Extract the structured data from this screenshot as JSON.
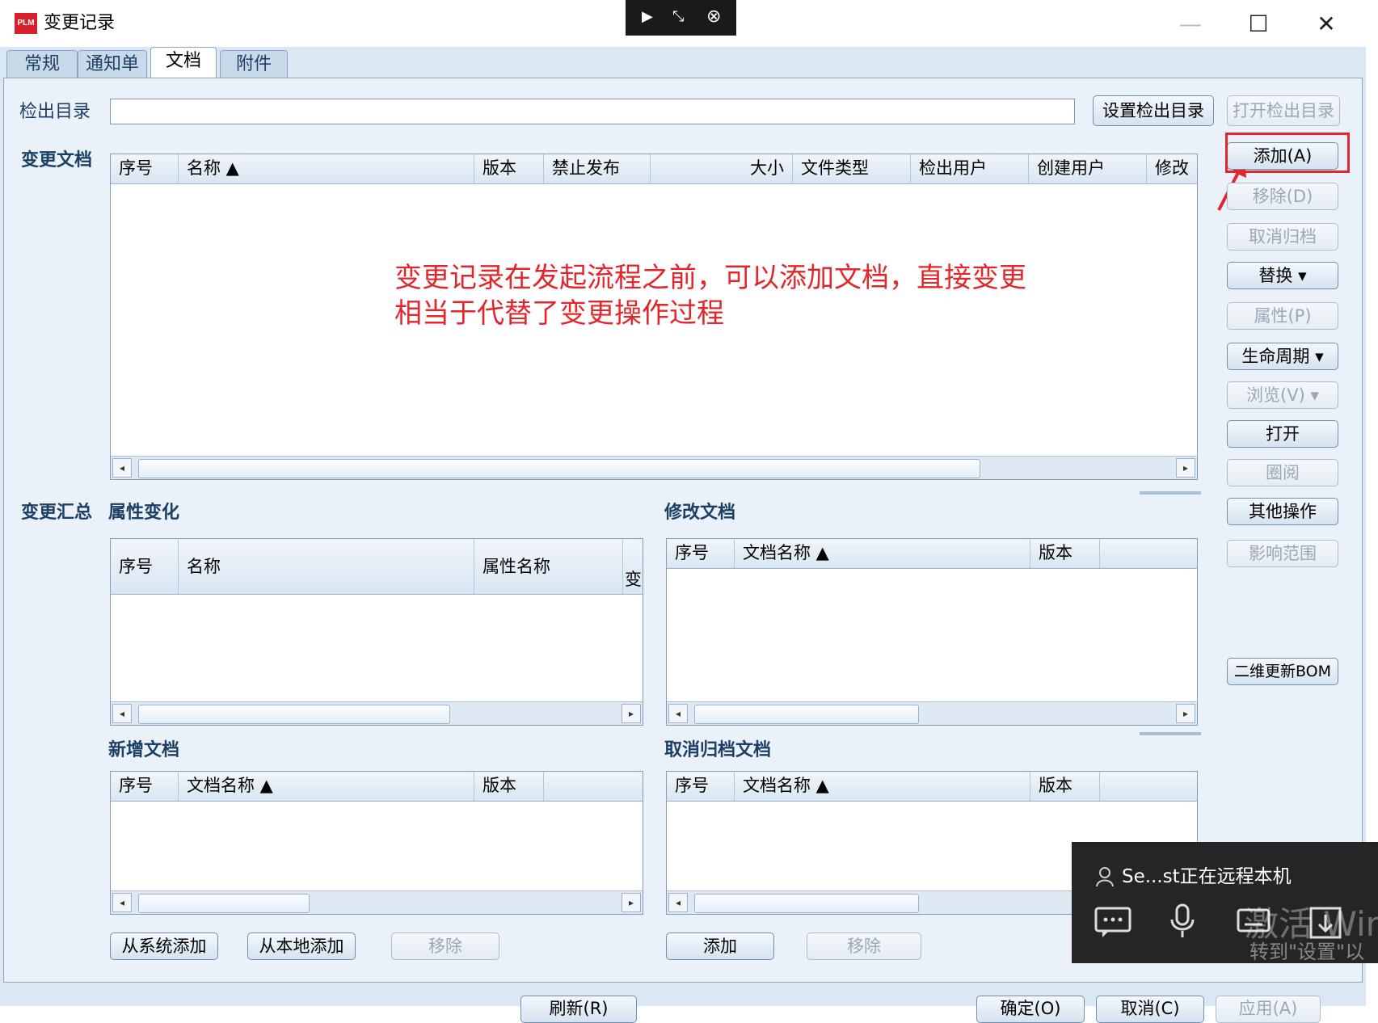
{
  "window": {
    "logo": "PLM",
    "title": "变更记录",
    "minimize": "—",
    "maximize": "☐",
    "close": "✕"
  },
  "remote_bar": {
    "pin": "▶",
    "restore": "⤡",
    "close": "⊗"
  },
  "tabs": [
    {
      "label": "常规",
      "active": false
    },
    {
      "label": "通知单",
      "active": false
    },
    {
      "label": "文档",
      "active": true
    },
    {
      "label": "附件",
      "active": false
    }
  ],
  "checkout": {
    "label": "检出目录",
    "value": "",
    "set_button": "设置检出目录",
    "open_button": "打开检出目录"
  },
  "change_docs": {
    "label": "变更文档",
    "columns": [
      "序号",
      "名称 ▲",
      "版本",
      "禁止发布",
      "大小",
      "文件类型",
      "检出用户",
      "创建用户",
      "修改"
    ]
  },
  "annotation": {
    "line1": "变更记录在发起流程之前，可以添加文档，直接变更",
    "line2": "相当于代替了变更操作过程"
  },
  "side_buttons": [
    {
      "label": "添加(A)",
      "enabled": true
    },
    {
      "label": "移除(D)",
      "enabled": false
    },
    {
      "label": "取消归档",
      "enabled": false
    },
    {
      "label": "替换 ▾",
      "enabled": true
    },
    {
      "label": "属性(P)",
      "enabled": false
    },
    {
      "label": "生命周期 ▾",
      "enabled": true
    },
    {
      "label": "浏览(V) ▾",
      "enabled": false
    },
    {
      "label": "打开",
      "enabled": true
    },
    {
      "label": "圈阅",
      "enabled": false
    },
    {
      "label": "其他操作",
      "enabled": true
    },
    {
      "label": "影响范围",
      "enabled": false
    },
    {
      "label": "二维更新BOM",
      "enabled": true
    }
  ],
  "summary": {
    "label": "变更汇总",
    "attr_change": {
      "label": "属性变化",
      "columns": [
        "序号",
        "名称",
        "属性名称",
        "变"
      ]
    },
    "modified_docs": {
      "label": "修改文档",
      "columns": [
        "序号",
        "文档名称 ▲",
        "版本"
      ]
    },
    "new_docs": {
      "label": "新增文档",
      "columns": [
        "序号",
        "文档名称 ▲",
        "版本"
      ]
    },
    "cancelled_docs": {
      "label": "取消归档文档",
      "columns": [
        "序号",
        "文档名称 ▲",
        "版本"
      ]
    }
  },
  "bottom_buttons": {
    "from_system": "从系统添加",
    "from_local": "从本地添加",
    "remove_left": "移除",
    "add_right": "添加",
    "remove_right": "移除"
  },
  "scroll_arrows": {
    "left": "◂",
    "right": "▸"
  },
  "footer_buttons": [
    "刷新(R)",
    "确定(O)",
    "取消(C)",
    "应用(A)"
  ],
  "remote_popup": {
    "text": "Se...st正在远程本机",
    "watermark1": "激活 Wind",
    "watermark2": "转到\"设置\"以"
  }
}
